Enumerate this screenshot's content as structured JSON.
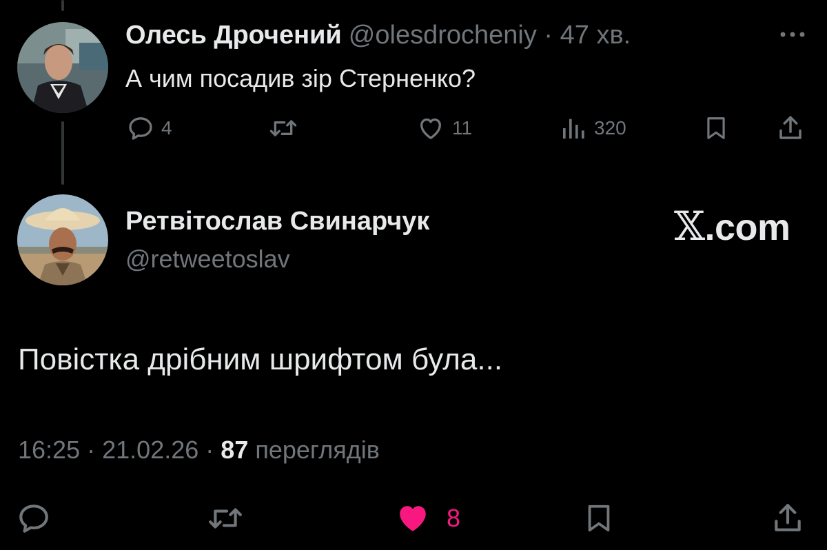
{
  "reply": {
    "author_name": "Олесь Дрочений",
    "author_handle": "@olesdrocheniy",
    "separator": "·",
    "time_ago": "47 хв.",
    "text": "А чим посадив зір Стерненко?",
    "actions": {
      "replies_icon": "comment-icon",
      "replies": "4",
      "retweets_icon": "retweet-icon",
      "likes_icon": "heart-outline-icon",
      "likes": "11",
      "views_icon": "analytics-icon",
      "views": "320",
      "bookmark_icon": "bookmark-icon",
      "share_icon": "share-icon"
    }
  },
  "tweet": {
    "author_name": "Ретвітослав Свинарчук",
    "author_handle": "@retweetoslav",
    "brand": {
      "x_glyph": "𝕏",
      "suffix": ".com"
    },
    "text": "Повістка дрібним шрифтом була...",
    "meta": {
      "time": "16:25",
      "separator": "·",
      "date": "21.02.26",
      "views_count": "87",
      "views_label": "переглядів"
    },
    "actions": {
      "reply_icon": "comment-icon",
      "retweet_icon": "retweet-icon",
      "like_icon": "heart-filled-icon",
      "likes": "8",
      "bookmark_icon": "bookmark-icon",
      "share_icon": "share-icon"
    }
  },
  "colors": {
    "background": "#000000",
    "primary_text": "#e7e9ea",
    "secondary_text": "#71767b",
    "like_pink": "#f91880",
    "thread_line": "#333639"
  }
}
